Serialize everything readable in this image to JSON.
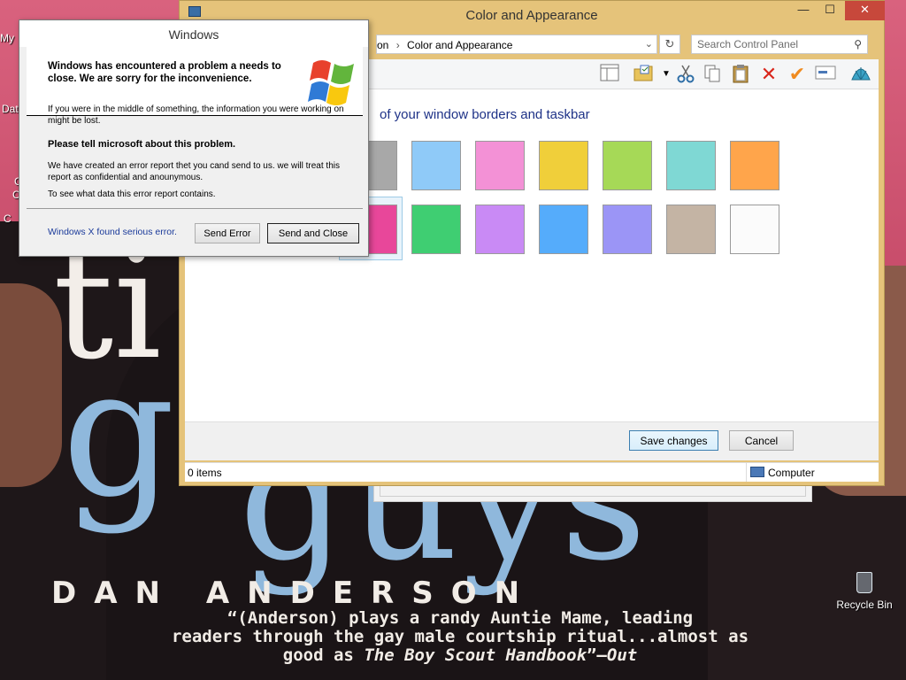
{
  "colors": {
    "window_border": "#e5c37a",
    "close_button": "#c7483b",
    "heading": "#1e3287",
    "error_footer_text": "#1a3a9a",
    "wallpaper_pink": "#c84d6b"
  },
  "desktop": {
    "icon_label_top": "My",
    "icon_label_mid": "Dat",
    "icon_label_side": "C",
    "recycle_bin": "Recycle Bin",
    "wallpaper": {
      "big_white": "ti",
      "big_blue_1": "g",
      "big_blue_2": "guys",
      "author": "DAN ANDERSON",
      "quote_line1": "“(Anderson) plays a randy Auntie Mame, leading",
      "quote_line2": "readers through the gay male courtship ritual...almost as",
      "quote_line3_start": "good as ",
      "quote_line3_italic": "The Boy Scout Handbook",
      "quote_line3_end": "”—",
      "quote_line3_source": "Out"
    }
  },
  "control_panel": {
    "title": "Color and Appearance",
    "caption_buttons": {
      "minimize": "—",
      "maximize": "☐",
      "close": "✕"
    },
    "address": {
      "crumb_prev": "on",
      "separator": "›",
      "crumb_current": "Color and Appearance",
      "dropdown_glyph": "⌄",
      "refresh_glyph": "↻"
    },
    "search": {
      "placeholder": "Search Control Panel",
      "value": "",
      "icon_glyph": "⚲"
    },
    "toolbar_icons": [
      "layout-icon",
      "folder-icon",
      "cut-icon",
      "copy-icon",
      "paste-icon",
      "delete-icon",
      "check-icon",
      "properties-icon",
      "shell-icon"
    ],
    "heading": "of your window borders and taskbar",
    "swatches_row1": [
      "#a8a8a8",
      "#8fcaf8",
      "#f391d6",
      "#f0cf3a",
      "#a6d957",
      "#7fd8d4",
      "#ffa54b"
    ],
    "swatches_row2": [
      "#e8479a",
      "#3fce72",
      "#c98af5",
      "#55acfb",
      "#9b95f6",
      "#c4b4a4",
      "#fbfbfb"
    ],
    "selected_swatch": "row2-0",
    "save_button": "Save changes",
    "cancel_button": "Cancel",
    "status_items": "0 items",
    "status_location": "Computer"
  },
  "error_dialog": {
    "title": "Windows",
    "header_message": "Windows has encountered a problem a needs to close. We are sorry for the inconvenience.",
    "p1": "If you were in the middle of something, the information you were working on might be lost.",
    "p2": "Please tell microsoft about this problem.",
    "p3": "We have created an error report thet you cand send to us. we will treat this report as confidential and anounymous.",
    "p4": "To see what data this error report contains.",
    "footer_text": "Windows X found serious error.",
    "send_error_button": "Send Error",
    "send_close_button": "Send and Close"
  }
}
